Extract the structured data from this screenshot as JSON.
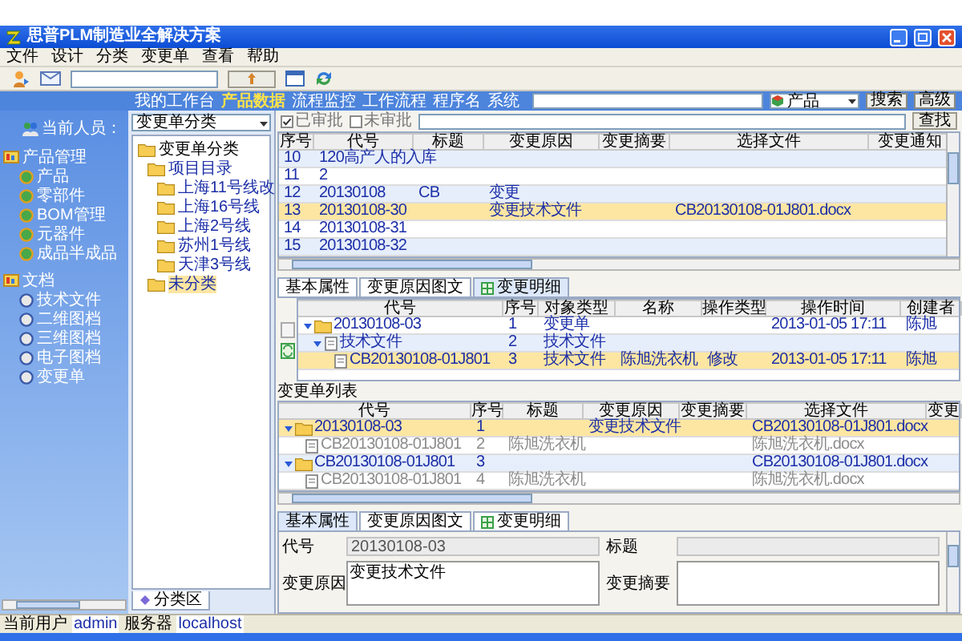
{
  "window": {
    "title": "思普PLM制造业全解决方案"
  },
  "menu": [
    "文件",
    "设计",
    "分类",
    "变更单",
    "查看",
    "帮助"
  ],
  "nav": {
    "links": [
      {
        "label": "我的工作台",
        "selected": false
      },
      {
        "label": "产品数据",
        "selected": true
      },
      {
        "label": "流程监控",
        "selected": false
      },
      {
        "label": "工作流程",
        "selected": false
      },
      {
        "label": "程序名",
        "selected": false
      },
      {
        "label": "系统",
        "selected": false
      }
    ],
    "scope": "产品",
    "buttons": [
      "搜索",
      "高级"
    ]
  },
  "sidebar": {
    "header": "当前人员：",
    "groups": [
      {
        "label": "产品管理",
        "items": [
          "产品",
          "零部件",
          "BOM管理",
          "元器件",
          "成品半成品"
        ]
      },
      {
        "label": "文档",
        "items": [
          "技术文件",
          "二维图档",
          "三维图档",
          "电子图档",
          "变更单"
        ]
      }
    ]
  },
  "tree": {
    "dropdown": "变更单分类",
    "nodes": [
      {
        "label": "变更单分类",
        "selected": false,
        "children": [
          {
            "label": "项目目录",
            "selected": false,
            "children": [
              {
                "label": "上海11号线改",
                "selected": false
              },
              {
                "label": "上海16号线",
                "selected": false
              },
              {
                "label": "上海2号线",
                "selected": false
              },
              {
                "label": "苏州1号线",
                "selected": false
              },
              {
                "label": "天津3号线",
                "selected": false
              }
            ]
          },
          {
            "label": "未分类",
            "selected": true
          }
        ]
      }
    ],
    "tab": "分类区"
  },
  "filter": {
    "checks": [
      {
        "label": "已审批",
        "checked": true
      },
      {
        "label": "未审批",
        "checked": false
      }
    ],
    "button": "查找"
  },
  "changes": {
    "columns": [
      "序号",
      "代号",
      "标题",
      "变更原因",
      "变更摘要",
      "选择文件",
      "变更通知"
    ],
    "rows": [
      {
        "cells": [
          "10",
          "120高产人的入库",
          null,
          null,
          null,
          null,
          null
        ],
        "selected": false
      },
      {
        "cells": [
          "11",
          "2",
          null,
          null,
          null,
          null,
          null
        ],
        "selected": false
      },
      {
        "cells": [
          "12",
          "20130108",
          "CB",
          "变更",
          null,
          null,
          null
        ],
        "selected": false
      },
      {
        "cells": [
          "13",
          "20130108-30",
          null,
          "变更技术文件",
          null,
          "CB20130108-01J801.docx",
          null
        ],
        "selected": true
      },
      {
        "cells": [
          "14",
          "20130108-31",
          null,
          null,
          null,
          null,
          null
        ],
        "selected": false
      },
      {
        "cells": [
          "15",
          "20130108-32",
          null,
          null,
          null,
          null,
          null
        ],
        "selected": false
      }
    ]
  },
  "detail_tabs": [
    {
      "label": "基本属性",
      "selected": false,
      "icon": false
    },
    {
      "label": "变更原因图文",
      "selected": false,
      "icon": false
    },
    {
      "label": "变更明细",
      "selected": true,
      "icon": true
    }
  ],
  "detail": {
    "columns": [
      "代号",
      "序号",
      "对象类型",
      "名称",
      "操作类型",
      "操作时间",
      "创建者"
    ],
    "rows": [
      {
        "cells": [
          "20130108-03",
          "1",
          "变更单",
          null,
          null,
          "2013-01-05 17:11",
          "陈旭"
        ],
        "kind": "folder",
        "expanded": true,
        "selected": false,
        "children": [
          {
            "cells": [
              "技术文件",
              "2",
              "技术文件",
              null,
              null,
              null,
              null
            ],
            "kind": "file",
            "expanded": true,
            "selected": false,
            "children": [
              {
                "cells": [
                  "CB20130108-01J801",
                  "3",
                  "技术文件",
                  "陈旭洗衣机",
                  "修改",
                  "2013-01-05 17:11",
                  "陈旭"
                ],
                "kind": "file",
                "selected": true
              }
            ]
          }
        ]
      }
    ]
  },
  "list_title": "变更单列表",
  "list": {
    "columns": [
      "代号",
      "序号",
      "标题",
      "变更原因",
      "变更摘要",
      "选择文件",
      "变更"
    ],
    "rows": [
      {
        "cells": [
          "20130108-03",
          "1",
          null,
          "变更技术文件",
          null,
          "CB20130108-01J801.docx",
          null
        ],
        "kind": "folder",
        "expanded": true,
        "selected": true,
        "dimmed": false,
        "children": [
          {
            "cells": [
              "CB20130108-01J801",
              "2",
              "陈旭洗衣机",
              null,
              null,
              "陈旭洗衣机.docx",
              null
            ],
            "kind": "file",
            "selected": false,
            "dimmed": true
          }
        ]
      },
      {
        "cells": [
          "CB20130108-01J801",
          "3",
          null,
          null,
          null,
          "CB20130108-01J801.docx",
          null
        ],
        "kind": "folder",
        "expanded": true,
        "selected": false,
        "dimmed": false,
        "children": [
          {
            "cells": [
              "CB20130108-01J801",
              "4",
              "陈旭洗衣机",
              null,
              null,
              "陈旭洗衣机.docx",
              null
            ],
            "kind": "file",
            "selected": false,
            "dimmed": true
          }
        ]
      }
    ]
  },
  "form_tabs": [
    {
      "label": "基本属性",
      "selected": true,
      "icon": false
    },
    {
      "label": "变更原因图文",
      "selected": false,
      "icon": false
    },
    {
      "label": "变更明细",
      "selected": false,
      "icon": true
    }
  ],
  "form": {
    "fields": [
      {
        "label": "代号",
        "value": "20130108-03",
        "kind": "line"
      },
      {
        "label": "标题",
        "kind": "line"
      },
      {
        "label": "变更原因",
        "value": "变更技术文件",
        "kind": "area"
      },
      {
        "label": "变更摘要",
        "kind": "area"
      }
    ]
  },
  "status": [
    {
      "label": "当前用户",
      "value": "admin"
    },
    {
      "label": "服务器",
      "value": "localhost"
    }
  ]
}
